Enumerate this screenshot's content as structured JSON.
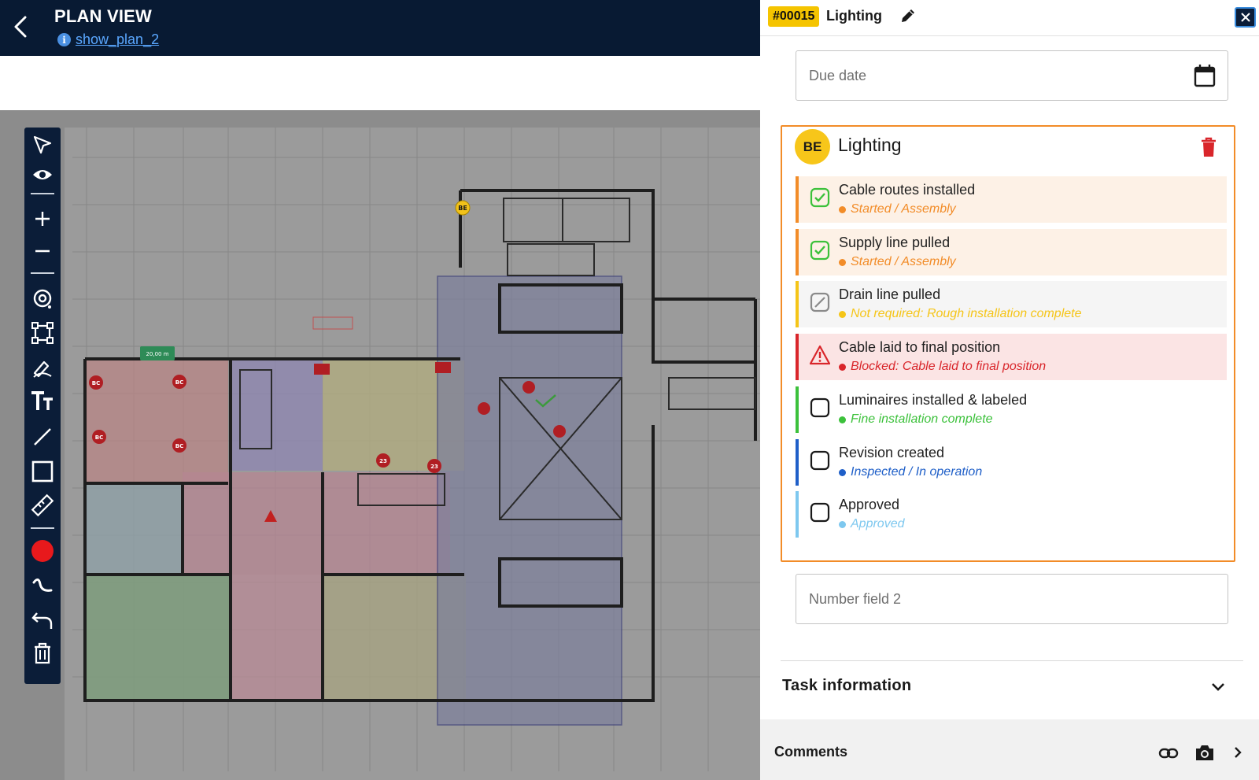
{
  "header": {
    "title": "PLAN VIEW",
    "plan_link": "show_plan_2",
    "info_glyph": "i"
  },
  "plan": {
    "marker_label": "BE",
    "pin_labels": [
      "BC",
      "BC",
      "BC",
      "BC",
      "23",
      "23"
    ],
    "dimension_label": "20,00 m",
    "background_color": "#8c8c8c"
  },
  "toolbar": {
    "tools": [
      "select-tool",
      "visibility-tool",
      "zoom-in-tool",
      "zoom-out-tool",
      "location-pin-tool",
      "area-tool",
      "markup-pen-tool",
      "text-tool",
      "line-tool",
      "rectangle-tool",
      "measure-tool",
      "color-picker",
      "freehand-tool",
      "undo-tool",
      "delete-tool"
    ],
    "active_color": "#e8191c"
  },
  "panel": {
    "task_id": "#00015",
    "task_title": "Lighting",
    "due_date_placeholder": "Due date",
    "number_field_placeholder": "Number field 2",
    "task_information_label": "Task information",
    "comments_label": "Comments"
  },
  "checklist": {
    "assignee_initials": "BE",
    "title": "Lighting",
    "items": [
      {
        "name": "Cable routes installed",
        "status": "Started / Assembly",
        "state": "checked",
        "color": "#f28c28",
        "bg": "#fdf1e6"
      },
      {
        "name": "Supply line pulled",
        "status": "Started / Assembly",
        "state": "checked",
        "color": "#f28c28",
        "bg": "#fdf1e6"
      },
      {
        "name": "Drain line pulled",
        "status": "Not required: Rough installation complete",
        "state": "not-required",
        "color": "#f5c518",
        "bg": "#f5f5f5"
      },
      {
        "name": "Cable laid to final position",
        "status": "Blocked: Cable laid to final position",
        "state": "blocked",
        "color": "#d9262b",
        "bg": "#fbe4e4"
      },
      {
        "name": "Luminaires installed & labeled",
        "status": "Fine installation complete",
        "state": "unchecked",
        "color": "#3cc13b",
        "bg": "#ffffff"
      },
      {
        "name": "Revision created",
        "status": "Inspected / In operation",
        "state": "unchecked",
        "color": "#1f5fc8",
        "bg": "#ffffff"
      },
      {
        "name": "Approved",
        "status": "Approved",
        "state": "unchecked",
        "color": "#7ec8ef",
        "bg": "#ffffff"
      }
    ]
  }
}
